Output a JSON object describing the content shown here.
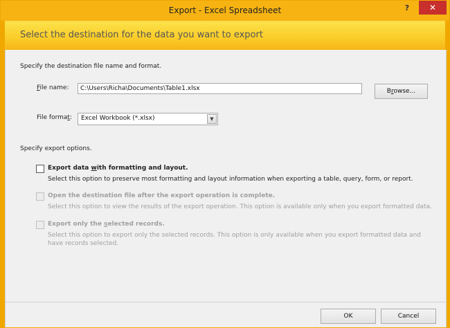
{
  "window": {
    "title": "Export - Excel Spreadsheet",
    "help_glyph": "?",
    "close_glyph": "✕"
  },
  "banner": {
    "text": "Select the destination for the data you want to export"
  },
  "destination": {
    "heading": "Specify the destination file name and format.",
    "file_name_label_access": "F",
    "file_name_label_rest": "ile name:",
    "file_name_value": "C:\\Users\\Richa\\Documents\\Table1.xlsx",
    "browse_label_pre": "B",
    "browse_label_access": "r",
    "browse_label_post": "owse...",
    "file_format_label_pre": "File forma",
    "file_format_label_access": "t",
    "file_format_label_post": ":",
    "file_format_value": "Excel Workbook (*.xlsx)"
  },
  "options": {
    "heading": "Specify export options.",
    "opt1": {
      "title_pre": "Export data ",
      "title_access": "w",
      "title_post": "ith formatting and layout.",
      "desc": "Select this option to preserve most formatting and layout information when exporting a table, query, form, or report.",
      "checked": false,
      "enabled": true
    },
    "opt2": {
      "title": "Open the destination file after the export operation is complete.",
      "desc": "Select this option to view the results of the export operation. This option is available only when you export formatted data.",
      "checked": false,
      "enabled": false
    },
    "opt3": {
      "title_pre": "Export only the ",
      "title_access": "s",
      "title_post": "elected records.",
      "desc_line1": "Select this option to export only the selected records. This option is only available when you export formatted data and",
      "desc_line2": "have records selected.",
      "checked": false,
      "enabled": false
    }
  },
  "footer": {
    "ok_label": "OK",
    "cancel_label": "Cancel"
  }
}
